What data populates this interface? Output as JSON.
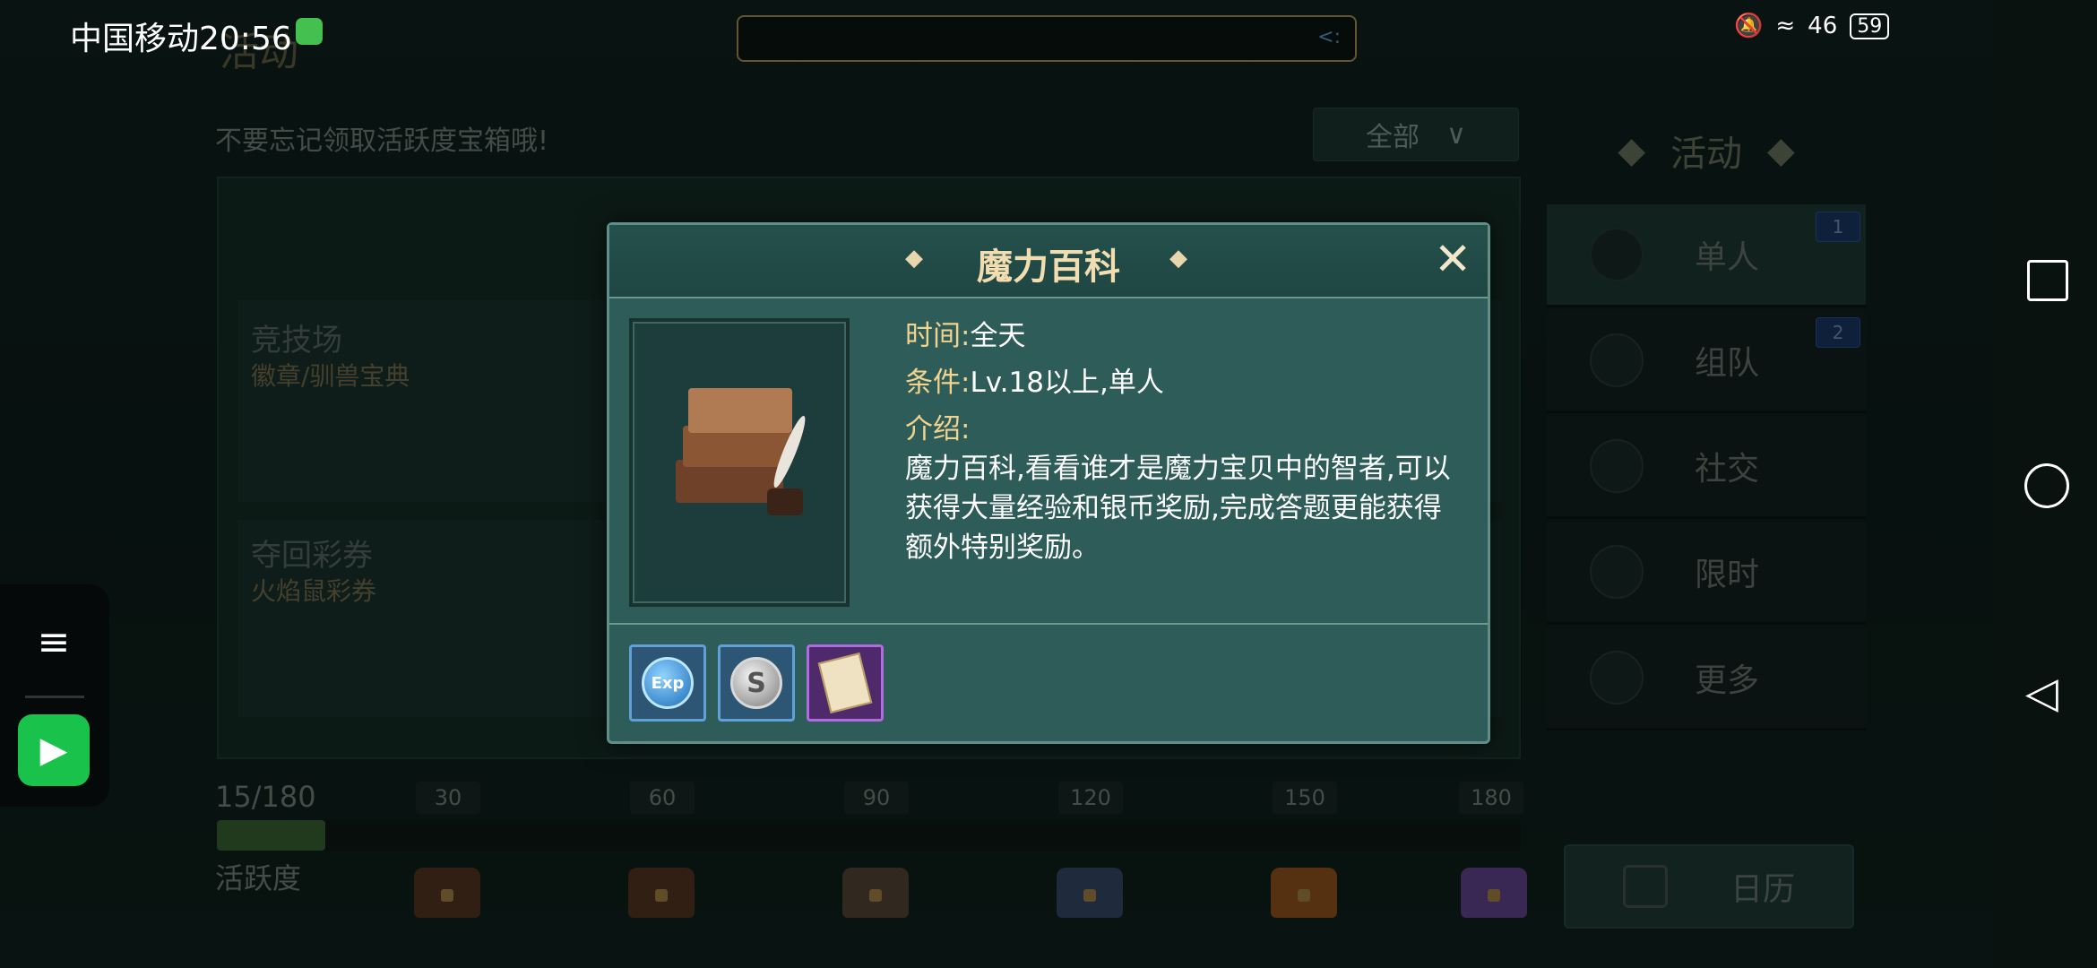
{
  "status_bar": {
    "carrier_time": "中国移动20:56",
    "signal_label": "46",
    "battery": "59"
  },
  "header": {
    "title": "活动",
    "reminder": "不要忘记领取活跃度宝箱哦!",
    "filter_label": "全部"
  },
  "cards": [
    {
      "title": "竞技场",
      "subtitle": "徽章/驯兽宝典"
    },
    {
      "title": "夺回彩券",
      "subtitle": "火焰鼠彩券"
    }
  ],
  "progress": {
    "count": "15/180",
    "current": 15,
    "max": 180,
    "label": "活跃度",
    "milestones": [
      "30",
      "60",
      "90",
      "120",
      "150",
      "180"
    ],
    "chest_colors": [
      "#5b3a24",
      "#5b3a24",
      "#5a4a3a",
      "#3a4e6e",
      "#9b5a20",
      "#6a4a9a"
    ]
  },
  "menu": {
    "title": "活动",
    "items": [
      {
        "label": "单人",
        "badge": "1",
        "icon": "person-icon"
      },
      {
        "label": "组队",
        "badge": "2",
        "icon": "team-icon"
      },
      {
        "label": "社交",
        "badge": "",
        "icon": "social-icon"
      },
      {
        "label": "限时",
        "badge": "",
        "icon": "clock-icon"
      },
      {
        "label": "更多",
        "badge": "",
        "icon": "grid-icon"
      }
    ],
    "calendar_label": "日历"
  },
  "modal": {
    "title": "魔力百科",
    "time_key": "时间:",
    "time_value": "全天",
    "cond_key": "条件:",
    "cond_value": "Lv.18以上,单人",
    "intro_key": "介绍:",
    "description": "魔力百科,看看谁才是魔力宝贝中的智者,可以获得大量经验和银币奖励,完成答题更能获得额外特别奖励。",
    "rewards": [
      {
        "name": "exp-reward",
        "label": "Exp"
      },
      {
        "name": "silver-coin-reward",
        "label": "S"
      },
      {
        "name": "paper-reward",
        "label": ""
      }
    ]
  },
  "colors": {
    "accent_gold": "#f1d38e",
    "panel_teal": "#2e5c59",
    "progress_green": "#3d6a37"
  }
}
